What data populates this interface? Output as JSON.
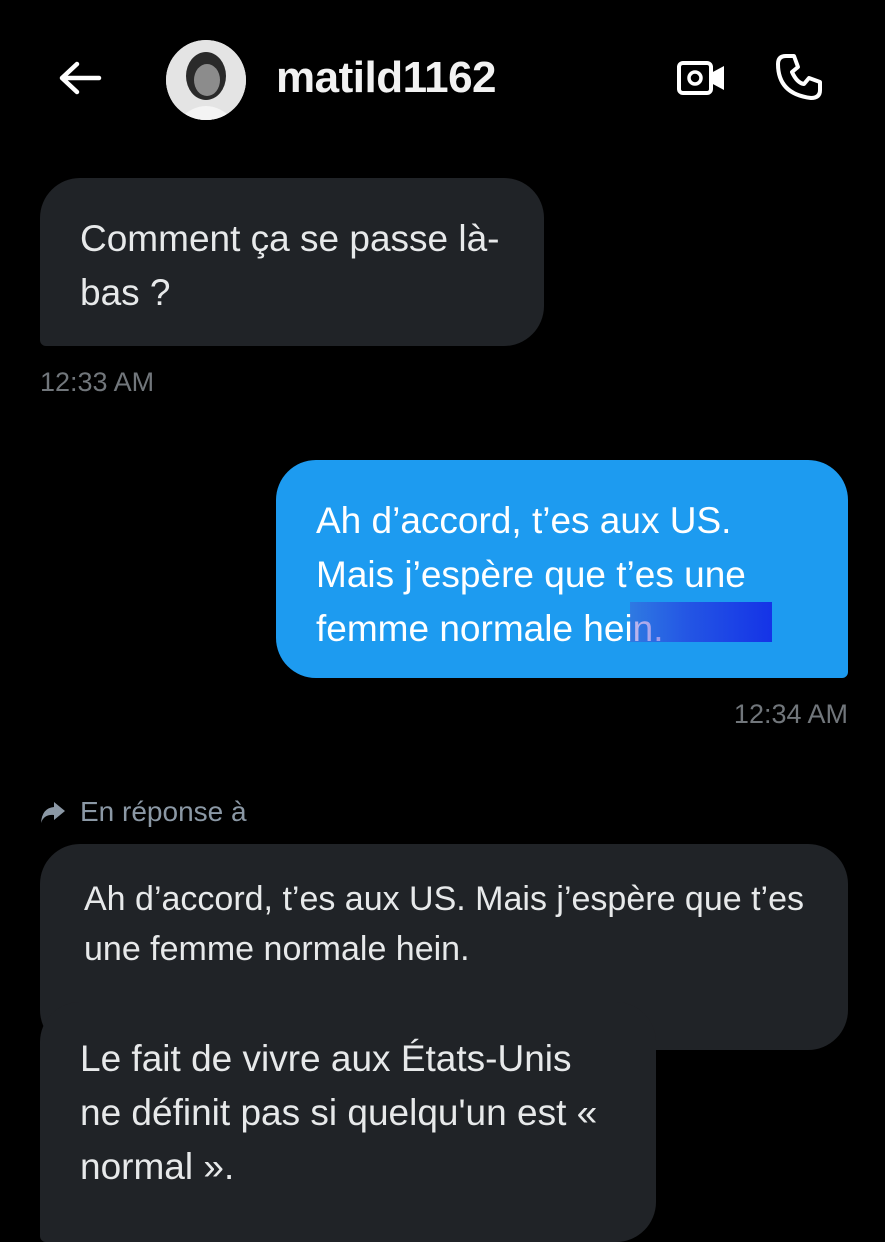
{
  "header": {
    "username": "matild1162",
    "back_icon": "arrow-left-icon",
    "video_icon": "video-camera-icon",
    "call_icon": "phone-icon"
  },
  "messages": [
    {
      "direction": "incoming",
      "text": "Comment ça se passe là-bas ?",
      "time": "12:33 AM"
    },
    {
      "direction": "outgoing",
      "text": "Ah d’accord, t’es aux US. Mais j’espère que t’es une femme normale hein.",
      "time": "12:34 AM"
    }
  ],
  "reply": {
    "label": "En réponse à",
    "icon": "reply-arrow-icon",
    "quoted_text": "Ah d’accord, t’es aux US. Mais j’espère que t’es une femme normale hein.",
    "response_text": "Le fait de vivre aux États-Unis ne définit pas si quelqu'un est « normal »."
  },
  "colors": {
    "background": "#000000",
    "incoming_bubble": "#202327",
    "outgoing_bubble": "#1d9bf0",
    "timestamp": "#71767b"
  }
}
